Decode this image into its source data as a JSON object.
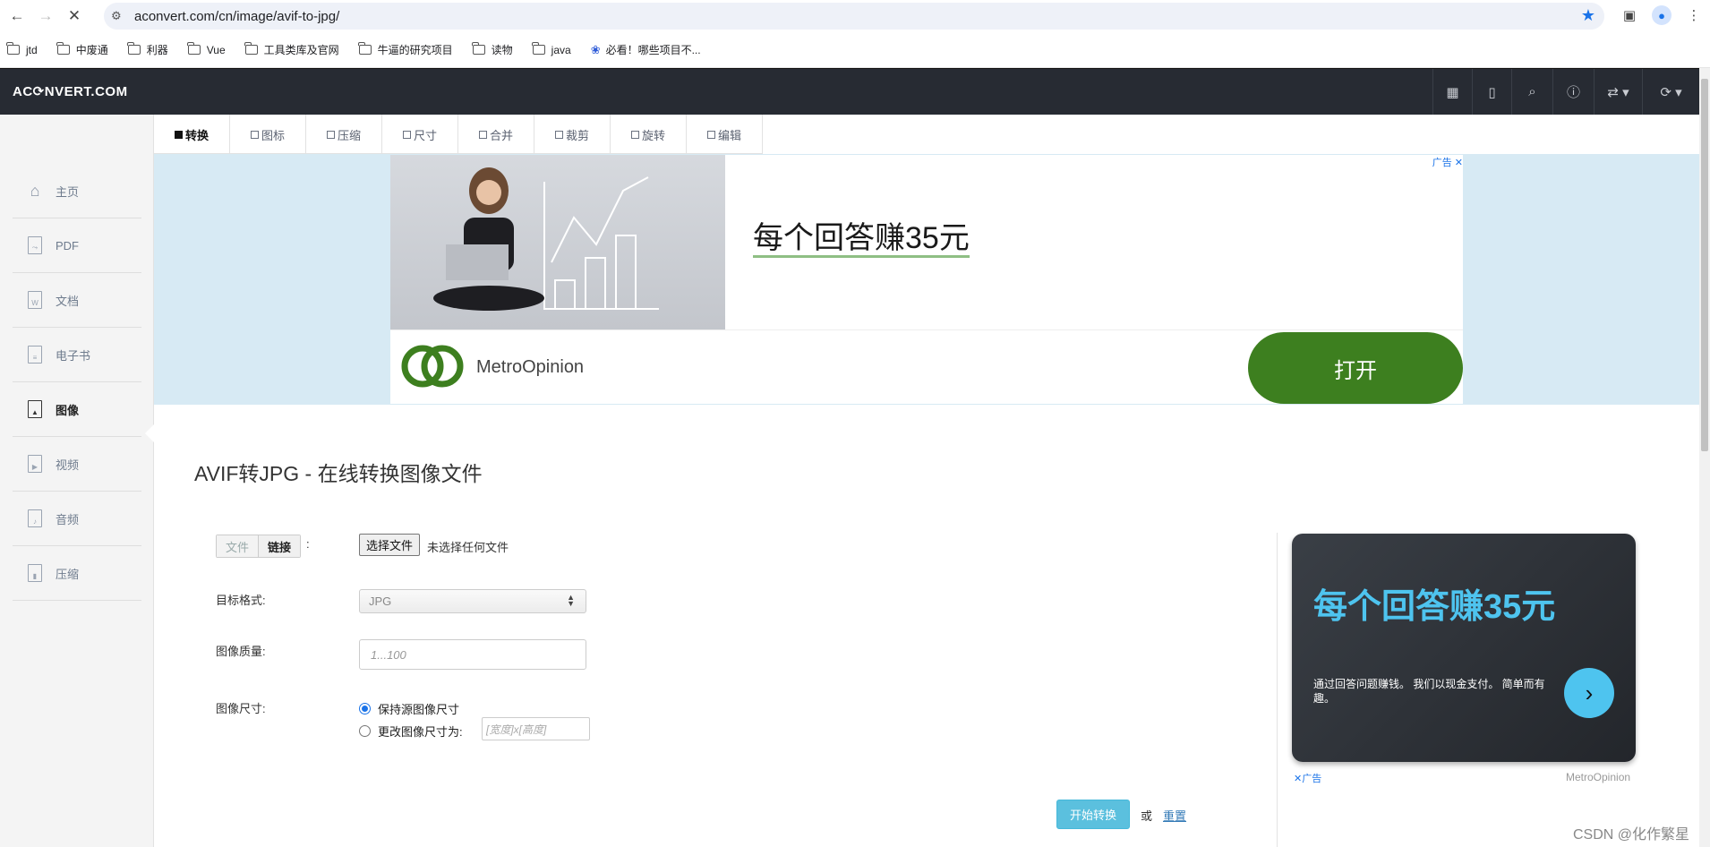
{
  "browser": {
    "url": "aconvert.com/cn/image/avif-to-jpg/",
    "bookmarks": [
      "jtd",
      "中废通",
      "利器",
      "Vue",
      "工具类库及官网",
      "牛逼的研究项目",
      "读物",
      "java",
      "必看！哪些项目不..."
    ]
  },
  "header": {
    "logo": "AC⟳NVERT.COM"
  },
  "sidebar": {
    "items": [
      {
        "label": "主页",
        "icon": "home-icon"
      },
      {
        "label": "PDF",
        "icon": "pdf-icon"
      },
      {
        "label": "文档",
        "icon": "word-doc-icon"
      },
      {
        "label": "电子书",
        "icon": "ebook-icon"
      },
      {
        "label": "图像",
        "icon": "image-icon",
        "active": true
      },
      {
        "label": "视频",
        "icon": "video-icon"
      },
      {
        "label": "音频",
        "icon": "audio-icon"
      },
      {
        "label": "压缩",
        "icon": "archive-icon"
      }
    ]
  },
  "tabs": [
    "转换",
    "图标",
    "压缩",
    "尺寸",
    "合并",
    "裁剪",
    "旋转",
    "编辑"
  ],
  "ad_banner": {
    "ad_label": "广告",
    "headline": "每个回答赚35元",
    "brand": "MetroOpinion",
    "button": "打开"
  },
  "main": {
    "title": "AVIF转JPG - 在线转换图像文件",
    "source_tab_file": "文件",
    "source_tab_link": "链接",
    "file_button": "选择文件",
    "file_status": "未选择任何文件",
    "target_format_label": "目标格式:",
    "target_format_value": "JPG",
    "quality_label": "图像质量:",
    "quality_placeholder": "1...100",
    "size_label": "图像尺寸:",
    "size_option_keep": "保持源图像尺寸",
    "size_option_change": "更改图像尺寸为:",
    "size_placeholder": "[宽度]x[高度]",
    "start_button": "开始转换",
    "or_text": "或",
    "reset_link": "重置"
  },
  "right_ad": {
    "title": "每个回答赚35元",
    "text": "通过回答问题赚钱。 我们以现金支付。 简单而有趣。",
    "footer_left": "✕广告",
    "footer_right": "MetroOpinion"
  },
  "watermark": "CSDN @化作繁星",
  "colors": {
    "header_bg": "#272b33",
    "ad_green": "#3d7f1f",
    "accent_cyan": "#5bc0de",
    "ad_title_cyan": "#4ec4ef"
  }
}
